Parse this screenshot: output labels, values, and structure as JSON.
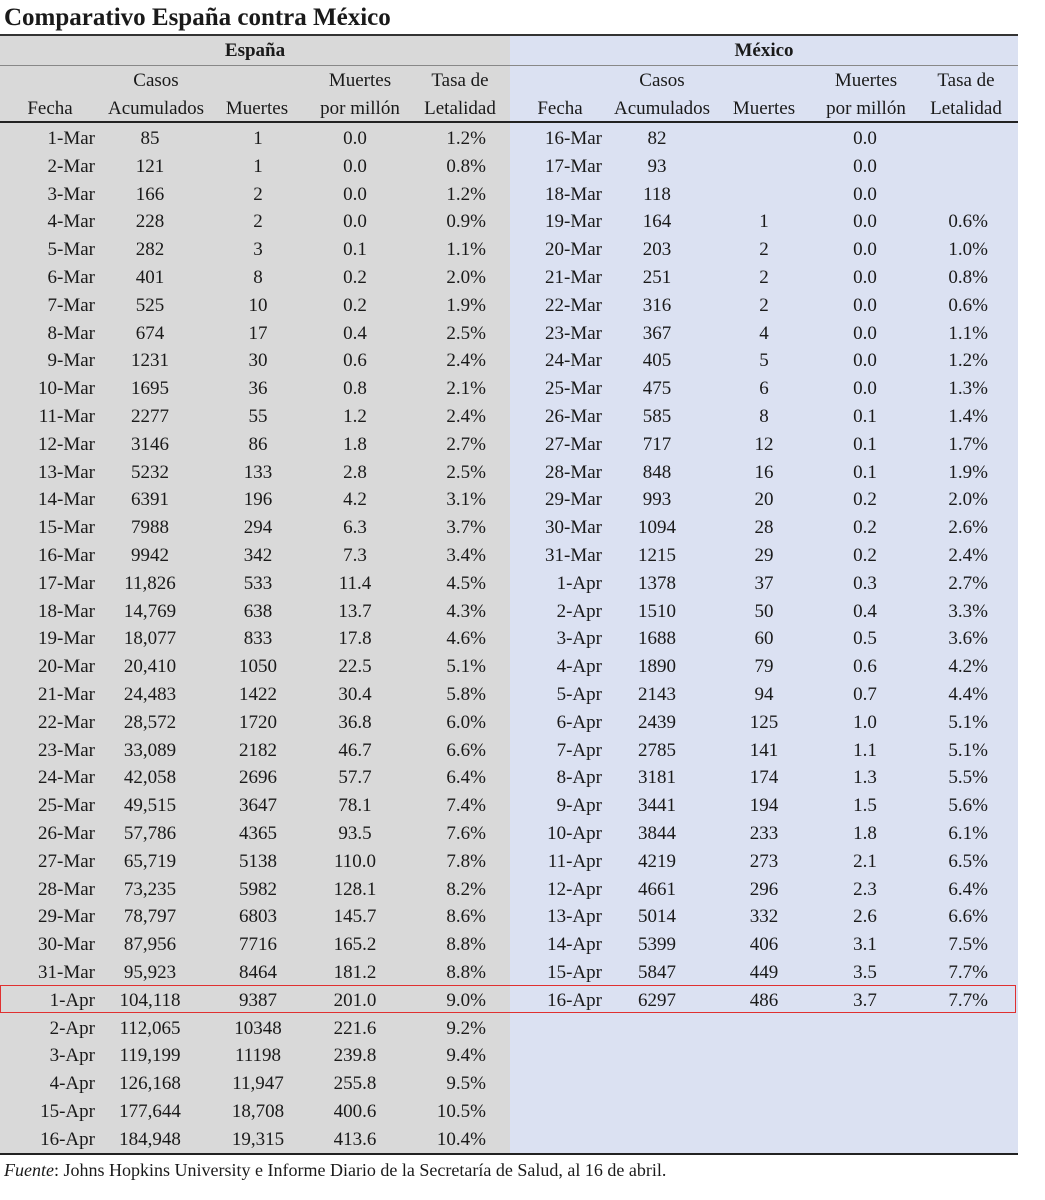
{
  "title": "Comparativo España contra México",
  "regions": {
    "spain": "España",
    "mexico": "México"
  },
  "headers": {
    "fecha": "Fecha",
    "casos_1": "Casos",
    "casos_2": "Acumulados",
    "muertes": "Muertes",
    "mpm_1": "Muertes",
    "mpm_2": "por millón",
    "tasa_1": "Tasa de",
    "tasa_2": "Letalidad"
  },
  "spain_rows": [
    [
      "1-Mar",
      "85",
      "1",
      "0.0",
      "1.2%"
    ],
    [
      "2-Mar",
      "121",
      "1",
      "0.0",
      "0.8%"
    ],
    [
      "3-Mar",
      "166",
      "2",
      "0.0",
      "1.2%"
    ],
    [
      "4-Mar",
      "228",
      "2",
      "0.0",
      "0.9%"
    ],
    [
      "5-Mar",
      "282",
      "3",
      "0.1",
      "1.1%"
    ],
    [
      "6-Mar",
      "401",
      "8",
      "0.2",
      "2.0%"
    ],
    [
      "7-Mar",
      "525",
      "10",
      "0.2",
      "1.9%"
    ],
    [
      "8-Mar",
      "674",
      "17",
      "0.4",
      "2.5%"
    ],
    [
      "9-Mar",
      "1231",
      "30",
      "0.6",
      "2.4%"
    ],
    [
      "10-Mar",
      "1695",
      "36",
      "0.8",
      "2.1%"
    ],
    [
      "11-Mar",
      "2277",
      "55",
      "1.2",
      "2.4%"
    ],
    [
      "12-Mar",
      "3146",
      "86",
      "1.8",
      "2.7%"
    ],
    [
      "13-Mar",
      "5232",
      "133",
      "2.8",
      "2.5%"
    ],
    [
      "14-Mar",
      "6391",
      "196",
      "4.2",
      "3.1%"
    ],
    [
      "15-Mar",
      "7988",
      "294",
      "6.3",
      "3.7%"
    ],
    [
      "16-Mar",
      "9942",
      "342",
      "7.3",
      "3.4%"
    ],
    [
      "17-Mar",
      "11,826",
      "533",
      "11.4",
      "4.5%"
    ],
    [
      "18-Mar",
      "14,769",
      "638",
      "13.7",
      "4.3%"
    ],
    [
      "19-Mar",
      "18,077",
      "833",
      "17.8",
      "4.6%"
    ],
    [
      "20-Mar",
      "20,410",
      "1050",
      "22.5",
      "5.1%"
    ],
    [
      "21-Mar",
      "24,483",
      "1422",
      "30.4",
      "5.8%"
    ],
    [
      "22-Mar",
      "28,572",
      "1720",
      "36.8",
      "6.0%"
    ],
    [
      "23-Mar",
      "33,089",
      "2182",
      "46.7",
      "6.6%"
    ],
    [
      "24-Mar",
      "42,058",
      "2696",
      "57.7",
      "6.4%"
    ],
    [
      "25-Mar",
      "49,515",
      "3647",
      "78.1",
      "7.4%"
    ],
    [
      "26-Mar",
      "57,786",
      "4365",
      "93.5",
      "7.6%"
    ],
    [
      "27-Mar",
      "65,719",
      "5138",
      "110.0",
      "7.8%"
    ],
    [
      "28-Mar",
      "73,235",
      "5982",
      "128.1",
      "8.2%"
    ],
    [
      "29-Mar",
      "78,797",
      "6803",
      "145.7",
      "8.6%"
    ],
    [
      "30-Mar",
      "87,956",
      "7716",
      "165.2",
      "8.8%"
    ],
    [
      "31-Mar",
      "95,923",
      "8464",
      "181.2",
      "8.8%"
    ],
    [
      "1-Apr",
      "104,118",
      "9387",
      "201.0",
      "9.0%"
    ],
    [
      "2-Apr",
      "112,065",
      "10348",
      "221.6",
      "9.2%"
    ],
    [
      "3-Apr",
      "119,199",
      "11198",
      "239.8",
      "9.4%"
    ],
    [
      "4-Apr",
      "126,168",
      "11,947",
      "255.8",
      "9.5%"
    ],
    [
      "15-Apr",
      "177,644",
      "18,708",
      "400.6",
      "10.5%"
    ],
    [
      "16-Apr",
      "184,948",
      "19,315",
      "413.6",
      "10.4%"
    ]
  ],
  "mexico_rows": [
    [
      "16-Mar",
      "82",
      "",
      "0.0",
      ""
    ],
    [
      "17-Mar",
      "93",
      "",
      "0.0",
      ""
    ],
    [
      "18-Mar",
      "118",
      "",
      "0.0",
      ""
    ],
    [
      "19-Mar",
      "164",
      "1",
      "0.0",
      "0.6%"
    ],
    [
      "20-Mar",
      "203",
      "2",
      "0.0",
      "1.0%"
    ],
    [
      "21-Mar",
      "251",
      "2",
      "0.0",
      "0.8%"
    ],
    [
      "22-Mar",
      "316",
      "2",
      "0.0",
      "0.6%"
    ],
    [
      "23-Mar",
      "367",
      "4",
      "0.0",
      "1.1%"
    ],
    [
      "24-Mar",
      "405",
      "5",
      "0.0",
      "1.2%"
    ],
    [
      "25-Mar",
      "475",
      "6",
      "0.0",
      "1.3%"
    ],
    [
      "26-Mar",
      "585",
      "8",
      "0.1",
      "1.4%"
    ],
    [
      "27-Mar",
      "717",
      "12",
      "0.1",
      "1.7%"
    ],
    [
      "28-Mar",
      "848",
      "16",
      "0.1",
      "1.9%"
    ],
    [
      "29-Mar",
      "993",
      "20",
      "0.2",
      "2.0%"
    ],
    [
      "30-Mar",
      "1094",
      "28",
      "0.2",
      "2.6%"
    ],
    [
      "31-Mar",
      "1215",
      "29",
      "0.2",
      "2.4%"
    ],
    [
      "1-Apr",
      "1378",
      "37",
      "0.3",
      "2.7%"
    ],
    [
      "2-Apr",
      "1510",
      "50",
      "0.4",
      "3.3%"
    ],
    [
      "3-Apr",
      "1688",
      "60",
      "0.5",
      "3.6%"
    ],
    [
      "4-Apr",
      "1890",
      "79",
      "0.6",
      "4.2%"
    ],
    [
      "5-Apr",
      "2143",
      "94",
      "0.7",
      "4.4%"
    ],
    [
      "6-Apr",
      "2439",
      "125",
      "1.0",
      "5.1%"
    ],
    [
      "7-Apr",
      "2785",
      "141",
      "1.1",
      "5.1%"
    ],
    [
      "8-Apr",
      "3181",
      "174",
      "1.3",
      "5.5%"
    ],
    [
      "9-Apr",
      "3441",
      "194",
      "1.5",
      "5.6%"
    ],
    [
      "10-Apr",
      "3844",
      "233",
      "1.8",
      "6.1%"
    ],
    [
      "11-Apr",
      "4219",
      "273",
      "2.1",
      "6.5%"
    ],
    [
      "12-Apr",
      "4661",
      "296",
      "2.3",
      "6.4%"
    ],
    [
      "13-Apr",
      "5014",
      "332",
      "2.6",
      "6.6%"
    ],
    [
      "14-Apr",
      "5399",
      "406",
      "3.1",
      "7.5%"
    ],
    [
      "15-Apr",
      "5847",
      "449",
      "3.5",
      "7.7%"
    ],
    [
      "16-Apr",
      "6297",
      "486",
      "3.7",
      "7.7%"
    ]
  ],
  "source": {
    "label": "Fuente",
    "text": ": Johns Hopkins University e Informe Diario de la Secretaría de Salud, al 16 de abril."
  }
}
